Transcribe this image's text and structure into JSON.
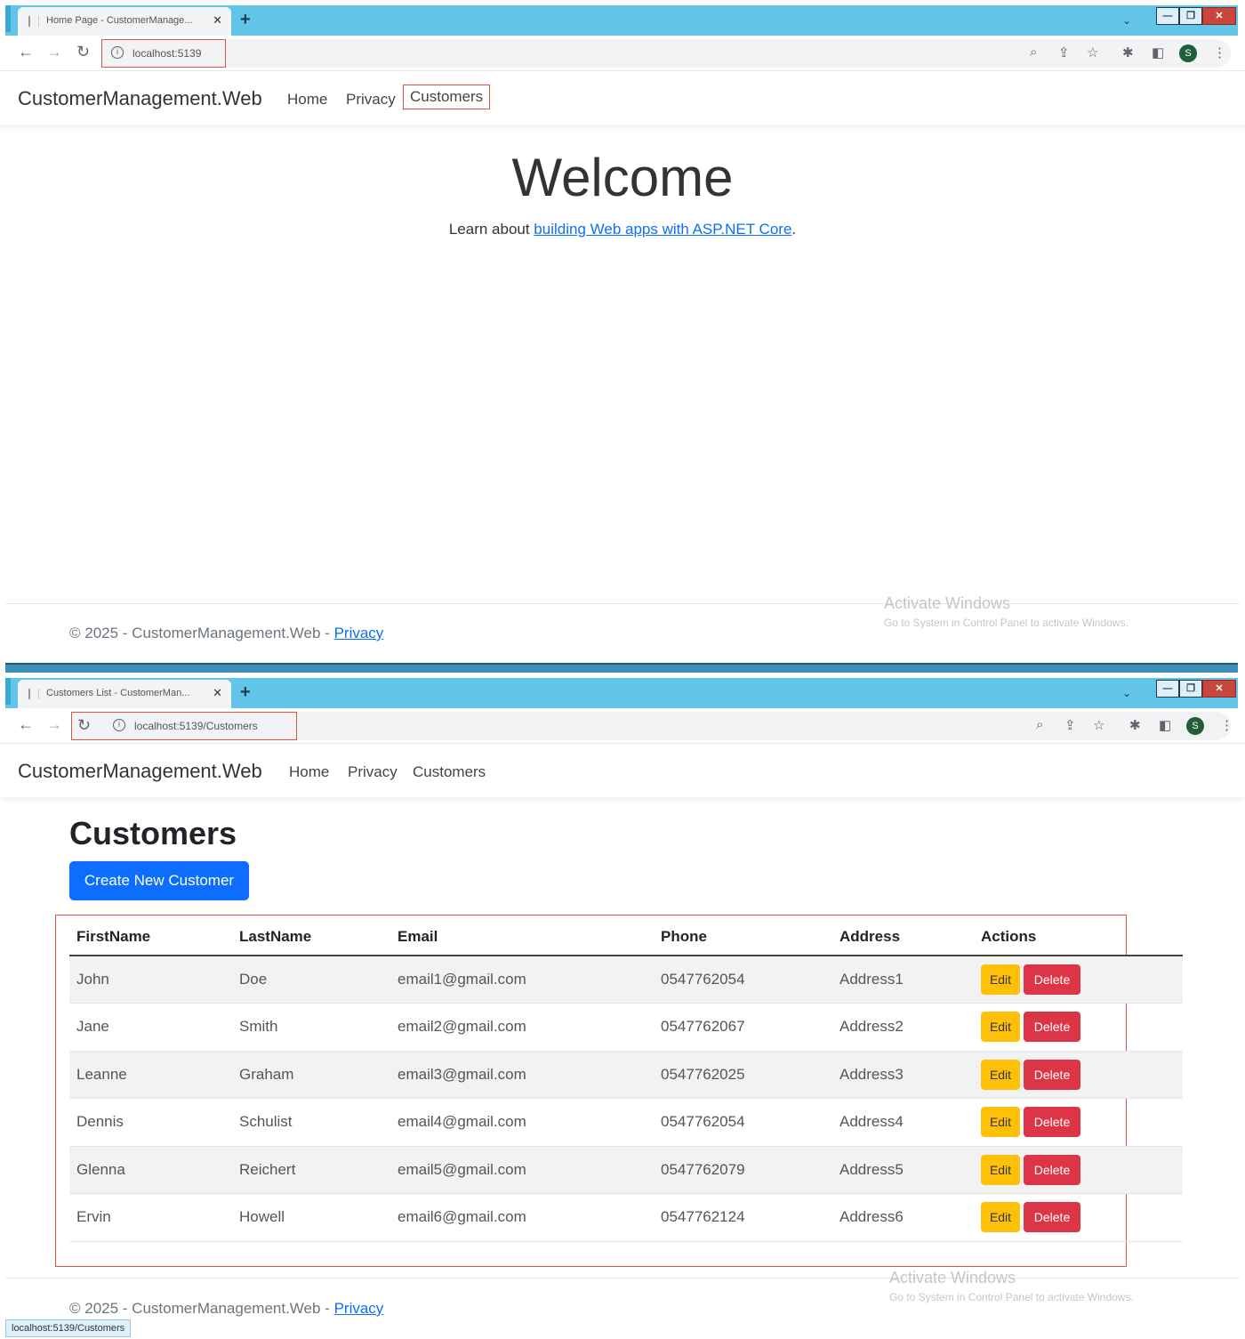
{
  "browser1": {
    "tab_title": "Home Page - CustomerManage...",
    "url": "localhost:5139",
    "profile_initial": "S"
  },
  "browser2": {
    "tab_title": "Customers List - CustomerMan...",
    "url": "localhost:5139/Customers",
    "profile_initial": "S",
    "status_url": "localhost:5139/Customers"
  },
  "app": {
    "brand": "CustomerManagement.Web",
    "nav": {
      "home": "Home",
      "privacy": "Privacy",
      "customers": "Customers"
    }
  },
  "home": {
    "heading": "Welcome",
    "learn_prefix": "Learn about ",
    "learn_link": "building Web apps with ASP.NET Core",
    "learn_suffix": "."
  },
  "footer": {
    "text": "© 2025 - CustomerManagement.Web - ",
    "privacy": "Privacy"
  },
  "watermark": {
    "line1": "Activate Windows",
    "line2": "Go to System in Control Panel to activate Windows."
  },
  "customers": {
    "heading": "Customers",
    "create_label": "Create New Customer",
    "columns": [
      "FirstName",
      "LastName",
      "Email",
      "Phone",
      "Address",
      "Actions"
    ],
    "edit_label": "Edit",
    "delete_label": "Delete",
    "rows": [
      [
        "John",
        "Doe",
        "email1@gmail.com",
        "0547762054",
        "Address1"
      ],
      [
        "Jane",
        "Smith",
        "email2@gmail.com",
        "0547762067",
        "Address2"
      ],
      [
        "Leanne",
        "Graham",
        "email3@gmail.com",
        "0547762025",
        "Address3"
      ],
      [
        "Dennis",
        "Schulist",
        "email4@gmail.com",
        "0547762054",
        "Address4"
      ],
      [
        "Glenna",
        "Reichert",
        "email5@gmail.com",
        "0547762079",
        "Address5"
      ],
      [
        "Ervin",
        "Howell",
        "email6@gmail.com",
        "0547762124",
        "Address6"
      ]
    ]
  },
  "colors": {
    "primary": "#0d6efd",
    "warning": "#ffc107",
    "danger": "#dc3545",
    "highlight": "#d9534f",
    "tabstrip": "#62c4e6"
  },
  "icons": {
    "back": "arrow-left-icon",
    "forward": "arrow-right-icon",
    "reload": "reload-icon",
    "info": "info-icon",
    "zoom": "zoom-icon",
    "share": "share-icon",
    "star": "star-icon",
    "extensions": "puzzle-icon",
    "sidepanel": "side-panel-icon",
    "menu": "kebab-menu-icon"
  }
}
